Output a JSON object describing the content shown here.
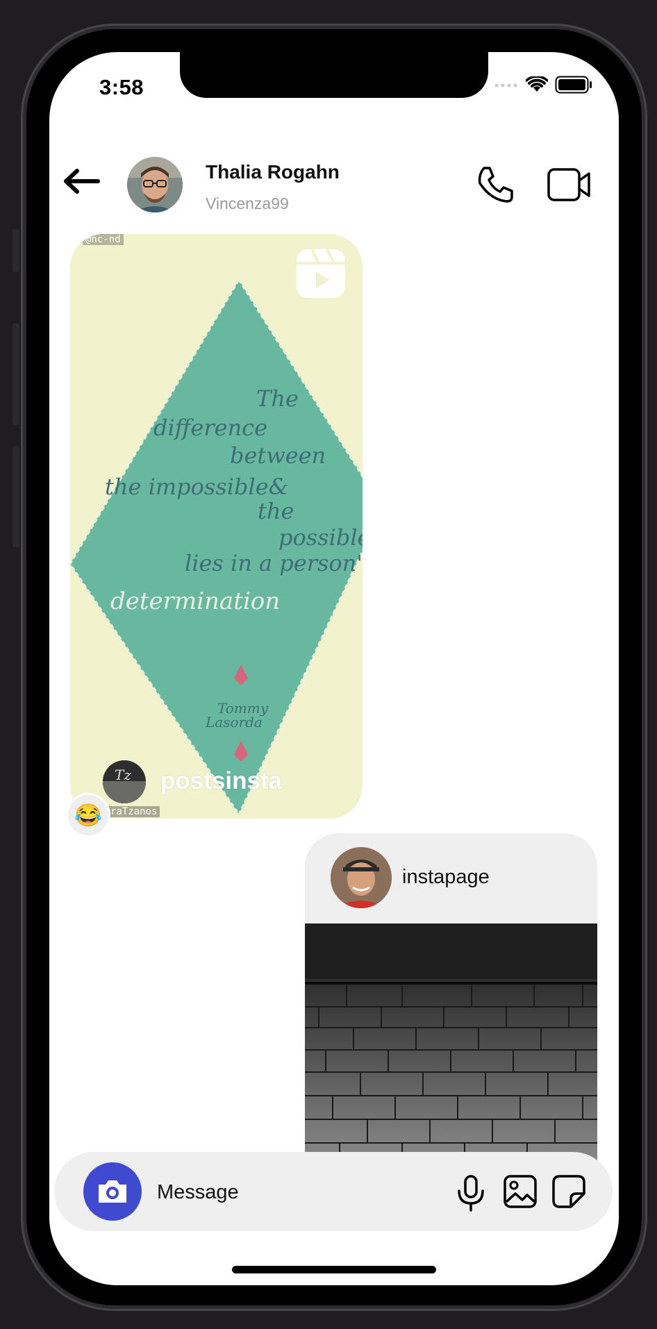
{
  "status_bar": {
    "time": "3:58"
  },
  "header": {
    "name": "Thalia Rogahn",
    "username": "Vincenza99"
  },
  "reel": {
    "license_tag": "@nc-nd",
    "author": "postsinsta",
    "watermark": "raTzanos",
    "quote_text": "The difference between the impossible & the possible lies in a person's determination",
    "quote_author": "Tommy Lasorda",
    "reaction": "😂"
  },
  "post": {
    "author": "instapage"
  },
  "composer": {
    "placeholder": "Message"
  },
  "colors": {
    "accent": "#3f4ad1",
    "reel_background": "#f2f2cd",
    "reel_diamond": "#68b8a0",
    "bubble_gray": "#efefef"
  },
  "icons": [
    "back-arrow-icon",
    "phone-icon",
    "video-camera-icon",
    "reels-icon",
    "camera-icon",
    "microphone-icon",
    "gallery-icon",
    "sticker-icon",
    "wifi-icon",
    "battery-icon",
    "signal-icon"
  ]
}
